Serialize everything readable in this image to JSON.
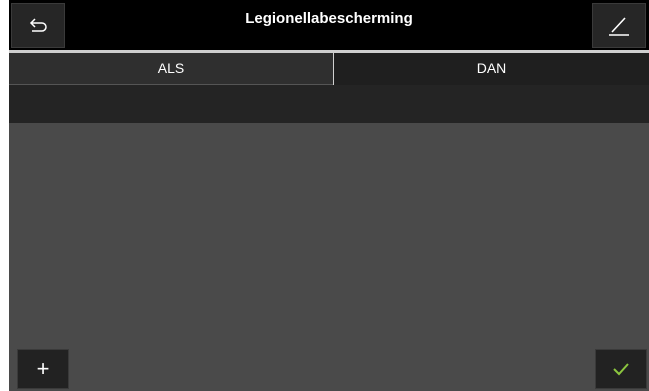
{
  "header": {
    "title": "Legionellabescherming",
    "back_icon": "back-arrow-icon",
    "edit_icon": "pencil-icon"
  },
  "tabs": [
    {
      "label": "ALS",
      "selected": false
    },
    {
      "label": "DAN",
      "selected": true
    }
  ],
  "footer": {
    "add_glyph": "+",
    "add_icon": "plus-icon",
    "confirm_icon": "checkmark-icon"
  },
  "colors": {
    "background": "#4a4a4a",
    "header": "#000000",
    "confirm_accent": "#8cc63f"
  }
}
